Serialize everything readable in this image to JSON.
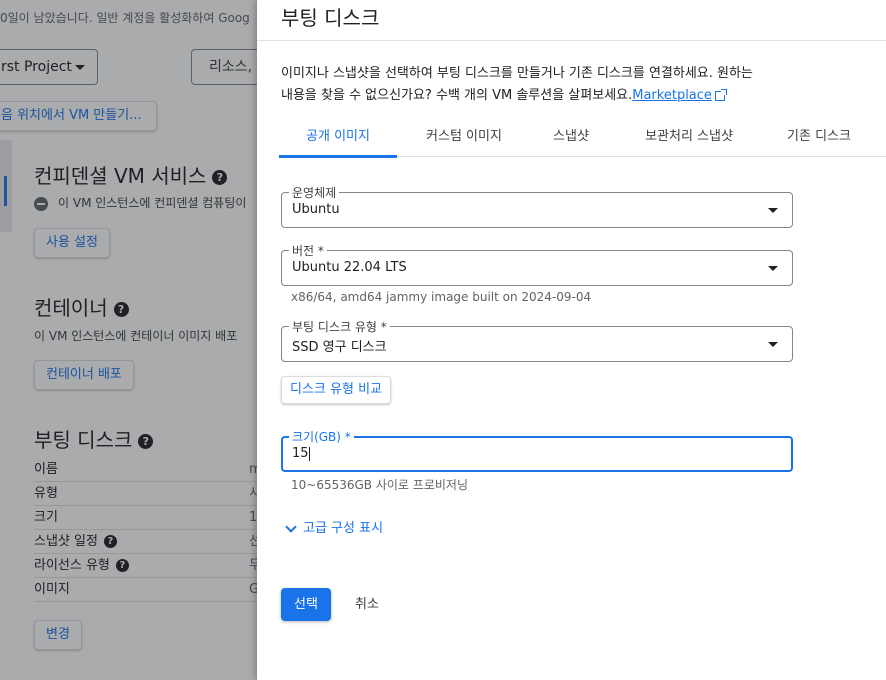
{
  "background": {
    "trial_notice": "0일이 남았습니다. 일반 계정을 활성화하여 Goog",
    "project_selector": "rst Project",
    "resource_button": "리소스,",
    "create_vm_button": "음 위치에서 VM 만들기...",
    "confidential": {
      "title": "컨피덴셜 VM 서비스",
      "desc": "이 VM 인스턴스에 컨피덴셜 컴퓨팅이",
      "button": "사용 설정"
    },
    "container": {
      "title": "컨테이너",
      "desc": "이 VM 인스턴스에 컨테이너 이미지 배포",
      "button": "컨테이너 배포"
    },
    "boot_disk": {
      "title": "부팅 디스크",
      "rows": [
        {
          "label": "이름",
          "value": "m"
        },
        {
          "label": "유형",
          "value": "시"
        },
        {
          "label": "크기",
          "value": "1"
        },
        {
          "label": "스냅샷 일정",
          "value": "선"
        },
        {
          "label": "라이선스 유형",
          "value": "무"
        },
        {
          "label": "이미지",
          "value": "G"
        }
      ],
      "button": "변경"
    }
  },
  "panel": {
    "title": "부팅 디스크",
    "intro_line1": "이미지나 스냅샷을 선택하여 부팅 디스크를 만들거나 기존 디스크를 연결하세요. 원하는",
    "intro_line2": "내용을 찾을 수 없으신가요? 수백 개의 VM 솔루션을 살펴보세요.",
    "marketplace_link": "Marketplace",
    "tabs": [
      {
        "label": "공개 이미지",
        "active": true
      },
      {
        "label": "커스텀 이미지",
        "active": false
      },
      {
        "label": "스냅샷",
        "active": false
      },
      {
        "label": "보관처리 스냅샷",
        "active": false
      },
      {
        "label": "기존 디스크",
        "active": false
      }
    ],
    "os": {
      "label": "운영체제",
      "value": "Ubuntu"
    },
    "version": {
      "label": "버전 *",
      "value": "Ubuntu 22.04 LTS",
      "hint": "x86/64, amd64 jammy image built on 2024-09-04"
    },
    "disk_type": {
      "label": "부팅 디스크 유형 *",
      "value": "SSD 영구 디스크"
    },
    "compare_button": "디스크 유형 비교",
    "size": {
      "label": "크기(GB) *",
      "value": "15",
      "hint": "10~65536GB 사이로 프로비저닝"
    },
    "advanced_toggle": "고급 구성 표시",
    "select_button": "선택",
    "cancel_button": "취소"
  },
  "colors": {
    "accent": "#1a73e8",
    "overlay": "#202124"
  }
}
